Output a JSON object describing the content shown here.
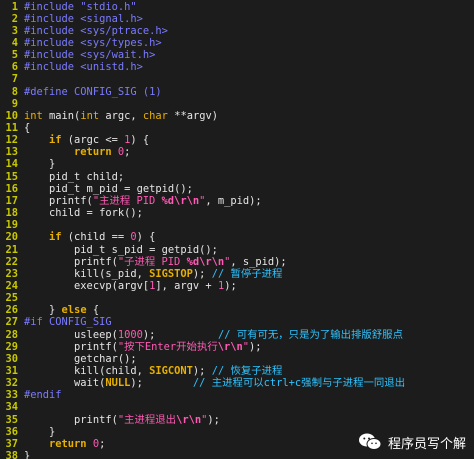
{
  "lines": [
    {
      "n": "1",
      "t": [
        [
          "pp",
          "#include \"stdio.h\""
        ]
      ]
    },
    {
      "n": "2",
      "t": [
        [
          "pp",
          "#include <signal.h>"
        ]
      ]
    },
    {
      "n": "3",
      "t": [
        [
          "pp",
          "#include <sys/ptrace.h>"
        ]
      ]
    },
    {
      "n": "4",
      "t": [
        [
          "pp",
          "#include <sys/types.h>"
        ]
      ]
    },
    {
      "n": "5",
      "t": [
        [
          "pp",
          "#include <sys/wait.h>"
        ]
      ]
    },
    {
      "n": "6",
      "t": [
        [
          "pp",
          "#include <unistd.h>"
        ]
      ]
    },
    {
      "n": "7",
      "t": []
    },
    {
      "n": "8",
      "t": [
        [
          "pp",
          "#define CONFIG_SIG (1)"
        ]
      ]
    },
    {
      "n": "9",
      "t": []
    },
    {
      "n": "10",
      "t": [
        [
          "typ",
          "int"
        ],
        [
          "plain",
          " main("
        ],
        [
          "typ",
          "int"
        ],
        [
          "plain",
          " argc, "
        ],
        [
          "typ",
          "char"
        ],
        [
          "plain",
          " **argv)"
        ]
      ]
    },
    {
      "n": "11",
      "t": [
        [
          "plain",
          "{"
        ]
      ]
    },
    {
      "n": "12",
      "t": [
        [
          "plain",
          "    "
        ],
        [
          "kw",
          "if"
        ],
        [
          "plain",
          " (argc <= "
        ],
        [
          "num",
          "1"
        ],
        [
          "plain",
          ") {"
        ]
      ]
    },
    {
      "n": "13",
      "t": [
        [
          "plain",
          "        "
        ],
        [
          "kw",
          "return"
        ],
        [
          "plain",
          " "
        ],
        [
          "num",
          "0"
        ],
        [
          "plain",
          ";"
        ]
      ]
    },
    {
      "n": "14",
      "t": [
        [
          "plain",
          "    }"
        ]
      ]
    },
    {
      "n": "15",
      "t": [
        [
          "plain",
          "    pid_t child;"
        ]
      ]
    },
    {
      "n": "16",
      "t": [
        [
          "plain",
          "    pid_t m_pid = getpid();"
        ]
      ]
    },
    {
      "n": "17",
      "t": [
        [
          "plain",
          "    printf("
        ],
        [
          "str",
          "\"主进程 PID "
        ],
        [
          "esc",
          "%d\\r\\n"
        ],
        [
          "str",
          "\""
        ],
        [
          "plain",
          ", m_pid);"
        ]
      ]
    },
    {
      "n": "18",
      "t": [
        [
          "plain",
          "    child = fork();"
        ]
      ]
    },
    {
      "n": "19",
      "t": []
    },
    {
      "n": "20",
      "t": [
        [
          "plain",
          "    "
        ],
        [
          "kw",
          "if"
        ],
        [
          "plain",
          " (child == "
        ],
        [
          "num",
          "0"
        ],
        [
          "plain",
          ") {"
        ]
      ]
    },
    {
      "n": "21",
      "t": [
        [
          "plain",
          "        pid_t s_pid = getpid();"
        ]
      ]
    },
    {
      "n": "22",
      "t": [
        [
          "plain",
          "        printf("
        ],
        [
          "str",
          "\"子进程 PID "
        ],
        [
          "esc",
          "%d\\r\\n"
        ],
        [
          "str",
          "\""
        ],
        [
          "plain",
          ", s_pid);"
        ]
      ]
    },
    {
      "n": "23",
      "t": [
        [
          "plain",
          "        kill(s_pid, "
        ],
        [
          "mac",
          "SIGSTOP"
        ],
        [
          "plain",
          "); "
        ],
        [
          "cmt",
          "// 暂停子进程"
        ]
      ]
    },
    {
      "n": "24",
      "t": [
        [
          "plain",
          "        execvp(argv["
        ],
        [
          "num",
          "1"
        ],
        [
          "plain",
          "], argv + "
        ],
        [
          "num",
          "1"
        ],
        [
          "plain",
          ");"
        ]
      ]
    },
    {
      "n": "25",
      "t": []
    },
    {
      "n": "26",
      "t": [
        [
          "plain",
          "    } "
        ],
        [
          "kw",
          "else"
        ],
        [
          "plain",
          " {"
        ]
      ]
    },
    {
      "n": "27",
      "t": [
        [
          "pp",
          "#if CONFIG_SIG"
        ]
      ]
    },
    {
      "n": "28",
      "t": [
        [
          "plain",
          "        usleep("
        ],
        [
          "num",
          "1000"
        ],
        [
          "plain",
          ");          "
        ],
        [
          "cmt",
          "// 可有可无，只是为了输出排版舒服点"
        ]
      ]
    },
    {
      "n": "29",
      "t": [
        [
          "plain",
          "        printf("
        ],
        [
          "str",
          "\"按下Enter开始执行"
        ],
        [
          "esc",
          "\\r\\n"
        ],
        [
          "str",
          "\""
        ],
        [
          "plain",
          ");"
        ]
      ]
    },
    {
      "n": "30",
      "t": [
        [
          "plain",
          "        getchar();"
        ]
      ]
    },
    {
      "n": "31",
      "t": [
        [
          "plain",
          "        kill(child, "
        ],
        [
          "mac",
          "SIGCONT"
        ],
        [
          "plain",
          "); "
        ],
        [
          "cmt",
          "// 恢复子进程"
        ]
      ]
    },
    {
      "n": "32",
      "t": [
        [
          "plain",
          "        wait("
        ],
        [
          "mac",
          "NULL"
        ],
        [
          "plain",
          ");        "
        ],
        [
          "cmt",
          "// 主进程可以ctrl+c强制与子进程一同退出"
        ]
      ]
    },
    {
      "n": "33",
      "t": [
        [
          "pp",
          "#endif"
        ]
      ]
    },
    {
      "n": "34",
      "t": []
    },
    {
      "n": "35",
      "t": [
        [
          "plain",
          "        printf("
        ],
        [
          "str",
          "\"主进程退出"
        ],
        [
          "esc",
          "\\r\\n"
        ],
        [
          "str",
          "\""
        ],
        [
          "plain",
          ");"
        ]
      ]
    },
    {
      "n": "36",
      "t": [
        [
          "plain",
          "    }"
        ]
      ]
    },
    {
      "n": "37",
      "t": [
        [
          "plain",
          "    "
        ],
        [
          "kw",
          "return"
        ],
        [
          "plain",
          " "
        ],
        [
          "num",
          "0"
        ],
        [
          "plain",
          ";"
        ]
      ]
    },
    {
      "n": "38",
      "t": [
        [
          "plain",
          "}"
        ]
      ]
    }
  ],
  "watermark": {
    "text": "程序员写个解",
    "icon": "wechat-icon"
  }
}
